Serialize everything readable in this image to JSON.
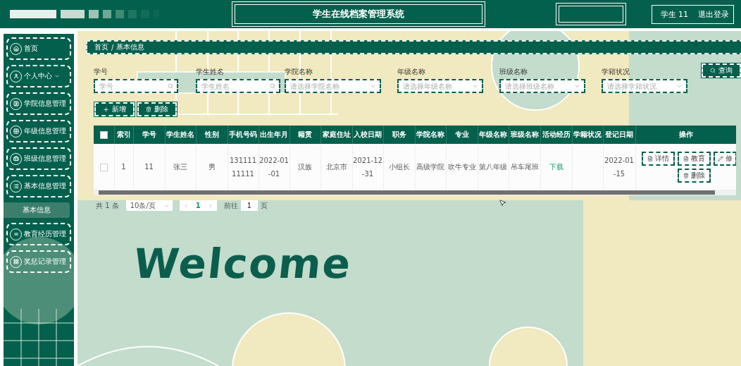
{
  "header": {
    "title": "学生在线档案管理系统",
    "user": "学生 11",
    "logout": "退出登录"
  },
  "sidebar": {
    "items": [
      {
        "label": "首页",
        "kind": "link"
      },
      {
        "label": "个人中心",
        "kind": "menu"
      },
      {
        "label": "学院信息管理",
        "kind": "link"
      },
      {
        "label": "年级信息管理",
        "kind": "link"
      },
      {
        "label": "班级信息管理",
        "kind": "link"
      },
      {
        "label": "基本信息管理",
        "kind": "link",
        "children": [
          {
            "label": "基本信息",
            "selected": true
          }
        ]
      },
      {
        "label": "教育经历管理",
        "kind": "link"
      },
      {
        "label": "奖惩记录管理",
        "kind": "link"
      }
    ]
  },
  "breadcrumb": [
    "首页",
    "基本信息"
  ],
  "breadcrumb_separator": "/",
  "filters": [
    {
      "label": "学号",
      "placeholder": "学号",
      "kind": "input"
    },
    {
      "label": "学生姓名",
      "placeholder": "学生姓名",
      "kind": "input"
    },
    {
      "label": "学院名称",
      "placeholder": "请选择学院名称",
      "kind": "select"
    },
    {
      "label": "年级名称",
      "placeholder": "请选择年级名称",
      "kind": "select"
    },
    {
      "label": "班级名称",
      "placeholder": "请选择班级名称",
      "kind": "select"
    },
    {
      "label": "学籍状况",
      "placeholder": "请选择学籍状况",
      "kind": "select"
    }
  ],
  "search_button": "查询",
  "toolbar": [
    {
      "label": "新增",
      "kind": "add"
    },
    {
      "label": "删除",
      "kind": "delete"
    }
  ],
  "table": {
    "select_all_checked": false,
    "columns": [
      "索引",
      "学号",
      "学生姓名",
      "性别",
      "手机号码",
      "出生年月",
      "籍贯",
      "家庭住址",
      "入校日期",
      "职务",
      "学院名称",
      "专业",
      "年级名称",
      "班级名称",
      "活动经历",
      "学籍状况",
      "登记日期",
      "操作"
    ],
    "rows": [
      {
        "checked": false,
        "cells": [
          {
            "kind": "text",
            "text": "1"
          },
          {
            "kind": "text",
            "text": "11"
          },
          {
            "kind": "text",
            "text": "张三"
          },
          {
            "kind": "text",
            "text": "男"
          },
          {
            "kind": "text",
            "text": "13111111111"
          },
          {
            "kind": "text",
            "text": "2022-01-01"
          },
          {
            "kind": "text",
            "text": "汉族"
          },
          {
            "kind": "text",
            "text": "北京市"
          },
          {
            "kind": "text",
            "text": "2021-12-31"
          },
          {
            "kind": "text",
            "text": "小组长"
          },
          {
            "kind": "text",
            "text": "高级学院"
          },
          {
            "kind": "text",
            "text": "吹牛专业"
          },
          {
            "kind": "text",
            "text": "第八年级"
          },
          {
            "kind": "text",
            "text": "吊车尾班"
          },
          {
            "kind": "link",
            "text": "下载"
          },
          {
            "kind": "empty"
          },
          {
            "kind": "text",
            "text": "2022-01-15"
          }
        ],
        "actions": [
          {
            "label": "详情",
            "kind": "detail"
          },
          {
            "label": "教育",
            "kind": "detail"
          },
          {
            "label": "修",
            "kind": "edit"
          },
          {
            "label": "删除",
            "kind": "delete"
          }
        ]
      }
    ]
  },
  "pagination": {
    "total": "共 1 条",
    "page_size": "10条/页",
    "pages": [
      {
        "label": "1",
        "selected": true
      }
    ],
    "goto_label": "前往",
    "goto_value": "1",
    "goto_suffix": "页"
  },
  "welcome": "Welcome"
}
